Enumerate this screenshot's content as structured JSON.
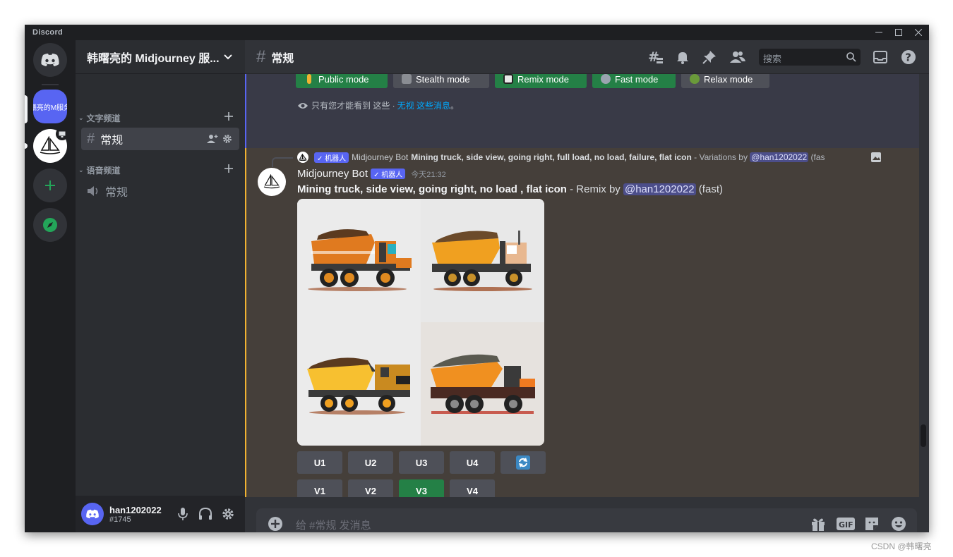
{
  "window": {
    "app_title": "Discord"
  },
  "servers": {
    "selected_label": "曦亮的M服务"
  },
  "sidebar": {
    "server_name": "韩曙亮的 Midjourney 服...",
    "categories": [
      {
        "label": "文字频道",
        "channels": [
          {
            "label": "常规"
          }
        ]
      },
      {
        "label": "语音频道",
        "channels": [
          {
            "label": "常规"
          }
        ]
      }
    ]
  },
  "user": {
    "name": "han1202022",
    "tag": "#1745"
  },
  "header": {
    "channel": "常规",
    "search_placeholder": "搜索"
  },
  "msg1": {
    "buttons": [
      {
        "label": "Public mode",
        "color": "#248046"
      },
      {
        "label": "Stealth mode",
        "color": "#4e5058"
      },
      {
        "label": "Remix mode",
        "color": "#248046"
      },
      {
        "label": "Fast mode",
        "color": "#248046"
      },
      {
        "label": "Relax mode",
        "color": "#4e5058"
      }
    ],
    "ephemeral_prefix": "只有您才能看到 这些 · ",
    "ephemeral_link": "无视 这些消息",
    "ephemeral_suffix": "。"
  },
  "msg2": {
    "reply": {
      "badge": "✓ 机器人",
      "author": "Midjourney Bot",
      "prompt": "Mining truck, side view, going right, full load, no load, failure, flat icon",
      "suffix": " - Variations by ",
      "mention": "@han1202022",
      "tail": " (fas"
    },
    "author": "Midjourney Bot",
    "badge": "✓ 机器人",
    "time": "今天21:32",
    "prompt": "Mining truck, side view, going right, no load , flat icon",
    "suffix": " - Remix by ",
    "mention": "@han1202022",
    "tail": " (fast)",
    "upscale_buttons": [
      "U1",
      "U2",
      "U3",
      "U4"
    ],
    "variation_buttons": [
      "V1",
      "V2",
      "V3",
      "V4"
    ],
    "selected_variation": "V3"
  },
  "composer": {
    "placeholder": "给 #常规 发消息"
  },
  "watermark": "CSDN @韩曙亮",
  "colors": {
    "blurple": "#5865f2",
    "green": "#248046",
    "gold": "#f0b232"
  }
}
